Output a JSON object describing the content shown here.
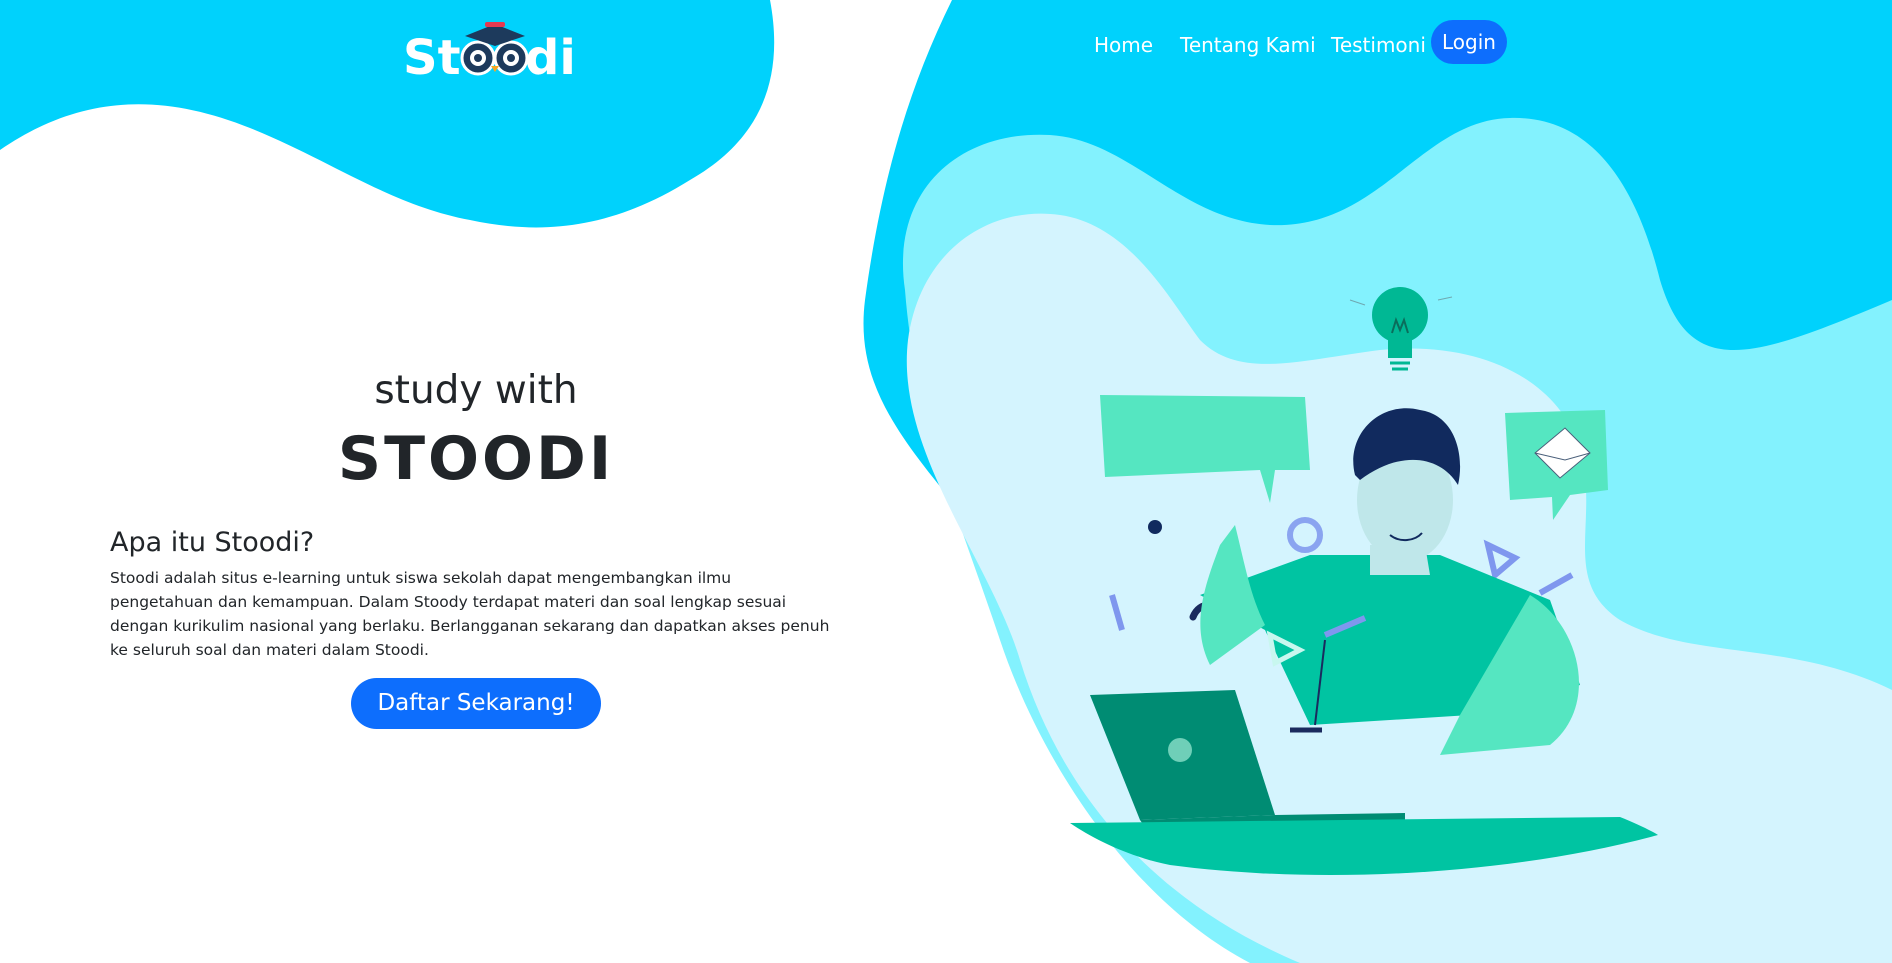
{
  "brand": {
    "name": "Stoodi",
    "colors": {
      "primary": "#0d6efd",
      "wave": "#00d2fc",
      "text": "#212529"
    }
  },
  "nav": {
    "items": [
      {
        "label": "Home"
      },
      {
        "label": "Tentang Kami"
      },
      {
        "label": "Testimoni"
      }
    ],
    "login_label": "Login"
  },
  "hero": {
    "subtitle": "study with",
    "title": "STOODI",
    "about_heading": "Apa itu Stoodi?",
    "about_text": "Stoodi adalah situs e-learning untuk siswa sekolah dapat mengembangkan ilmu pengetahuan dan kemampuan. Dalam Stoody terdapat materi dan soal lengkap sesuai dengan kurikulim nasional yang berlaku. Berlangganan sekarang dan dapatkan akses penuh ke seluruh soal dan materi dalam Stoodi.",
    "cta_label": "Daftar Sekarang!"
  },
  "illustration": {
    "icons": [
      "lightbulb-icon",
      "speech-bubble-icon",
      "envelope-icon",
      "laptop-icon",
      "play-icon"
    ]
  }
}
